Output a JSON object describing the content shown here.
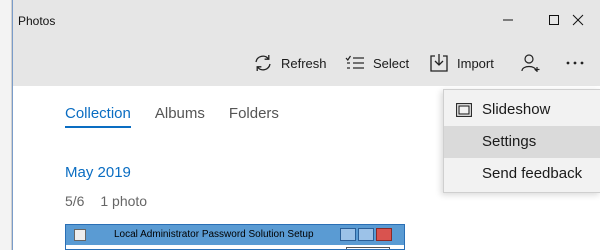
{
  "window": {
    "title": "Photos"
  },
  "toolbar": {
    "refresh_label": "Refresh",
    "select_label": "Select",
    "import_label": "Import"
  },
  "tabs": [
    {
      "label": "Collection",
      "active": true
    },
    {
      "label": "Albums",
      "active": false
    },
    {
      "label": "Folders",
      "active": false
    }
  ],
  "collection": {
    "group_title": "May 2019",
    "group_date": "5/6",
    "group_count": "1 photo",
    "thumbnail_caption": "Local Administrator Password Solution Setup"
  },
  "menu": {
    "items": [
      {
        "label": "Slideshow",
        "icon": "slideshow-icon"
      },
      {
        "label": "Settings",
        "icon": null,
        "highlighted": true
      },
      {
        "label": "Send feedback",
        "icon": null
      }
    ]
  },
  "colors": {
    "accent": "#0a6dc2",
    "chrome": "#e6e6e6",
    "menu_bg": "#f2f2f2",
    "menu_hover": "#dadada"
  }
}
